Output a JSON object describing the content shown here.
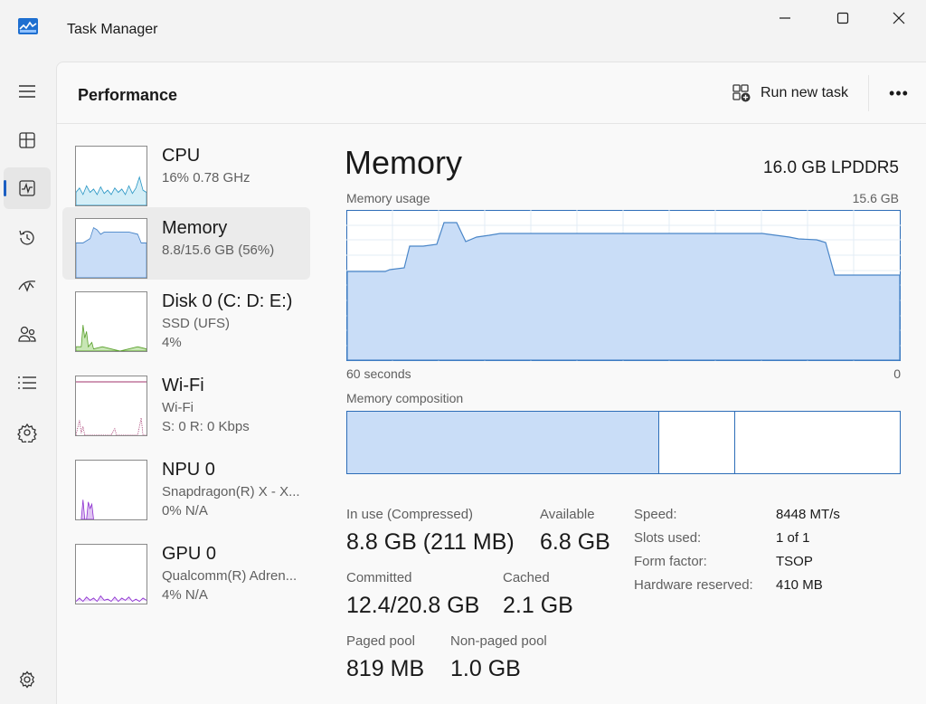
{
  "window": {
    "title": "Task Manager"
  },
  "nav": {
    "items": [
      {
        "icon": "hamburger-menu-icon"
      },
      {
        "icon": "processes-icon"
      },
      {
        "icon": "performance-icon"
      },
      {
        "icon": "app-history-icon"
      },
      {
        "icon": "startup-apps-icon"
      },
      {
        "icon": "users-icon"
      },
      {
        "icon": "details-icon"
      },
      {
        "icon": "services-icon"
      },
      {
        "icon": "settings-icon"
      }
    ]
  },
  "header": {
    "title": "Performance",
    "run_new_task": "Run new task",
    "more": "•••"
  },
  "devices": [
    {
      "name": "CPU",
      "sub1": "16%  0.78 GHz",
      "sub2": ""
    },
    {
      "name": "Memory",
      "sub1": "8.8/15.6 GB (56%)",
      "sub2": ""
    },
    {
      "name": "Disk 0 (C: D: E:)",
      "sub1": "SSD (UFS)",
      "sub2": "4%"
    },
    {
      "name": "Wi-Fi",
      "sub1": "Wi-Fi",
      "sub2": "S: 0  R: 0 Kbps"
    },
    {
      "name": "NPU 0",
      "sub1": "Snapdragon(R) X - X...",
      "sub2": "0%  N/A"
    },
    {
      "name": "GPU 0",
      "sub1": "Qualcomm(R) Adren...",
      "sub2": "4%  N/A"
    }
  ],
  "detail": {
    "title": "Memory",
    "spec": "16.0 GB LPDDR5",
    "usage_label": "Memory usage",
    "usage_max": "15.6 GB",
    "time_left": "60 seconds",
    "time_right": "0",
    "composition_label": "Memory composition",
    "composition_fractions": {
      "in_use": 0.565,
      "modified": 0.137,
      "standby": 0.298
    },
    "stats": {
      "in_use_label": "In use (Compressed)",
      "in_use_value": "8.8 GB (211 MB)",
      "available_label": "Available",
      "available_value": "6.8 GB",
      "committed_label": "Committed",
      "committed_value": "12.4/20.8 GB",
      "cached_label": "Cached",
      "cached_value": "2.1 GB",
      "paged_label": "Paged pool",
      "paged_value": "819 MB",
      "nonpaged_label": "Non-paged pool",
      "nonpaged_value": "1.0 GB"
    },
    "specs": [
      {
        "key": "Speed:",
        "value": "8448 MT/s"
      },
      {
        "key": "Slots used:",
        "value": "1 of 1"
      },
      {
        "key": "Form factor:",
        "value": "TSOP"
      },
      {
        "key": "Hardware reserved:",
        "value": "410 MB"
      }
    ]
  },
  "colors": {
    "memory_fill": "#c9ddf7",
    "memory_line": "#4a86c8",
    "accent": "#1c5fc2"
  }
}
